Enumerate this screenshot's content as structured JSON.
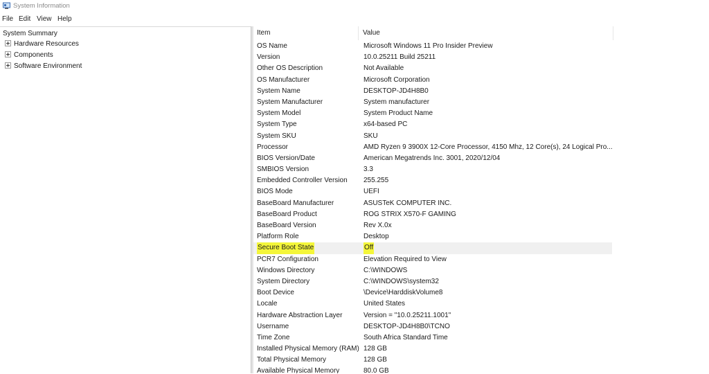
{
  "window": {
    "title": "System Information"
  },
  "menu": [
    "File",
    "Edit",
    "View",
    "Help"
  ],
  "tree": {
    "root": "System Summary",
    "nodes": [
      "Hardware Resources",
      "Components",
      "Software Environment"
    ]
  },
  "table": {
    "headers": {
      "item": "Item",
      "value": "Value"
    },
    "rows": [
      {
        "item": "OS Name",
        "value": "Microsoft Windows 11 Pro Insider Preview"
      },
      {
        "item": "Version",
        "value": "10.0.25211 Build 25211"
      },
      {
        "item": "Other OS Description",
        "value": "Not Available"
      },
      {
        "item": "OS Manufacturer",
        "value": "Microsoft Corporation"
      },
      {
        "item": "System Name",
        "value": "DESKTOP-JD4H8B0"
      },
      {
        "item": "System Manufacturer",
        "value": "System manufacturer"
      },
      {
        "item": "System Model",
        "value": "System Product Name"
      },
      {
        "item": "System Type",
        "value": "x64-based PC"
      },
      {
        "item": "System SKU",
        "value": "SKU"
      },
      {
        "item": "Processor",
        "value": "AMD Ryzen 9 3900X 12-Core Processor, 4150 Mhz, 12 Core(s), 24 Logical Pro..."
      },
      {
        "item": "BIOS Version/Date",
        "value": "American Megatrends Inc. 3001, 2020/12/04"
      },
      {
        "item": "SMBIOS Version",
        "value": "3.3"
      },
      {
        "item": "Embedded Controller Version",
        "value": "255.255"
      },
      {
        "item": "BIOS Mode",
        "value": "UEFI"
      },
      {
        "item": "BaseBoard Manufacturer",
        "value": "ASUSTeK COMPUTER INC."
      },
      {
        "item": "BaseBoard Product",
        "value": "ROG STRIX X570-F GAMING"
      },
      {
        "item": "BaseBoard Version",
        "value": "Rev X.0x"
      },
      {
        "item": "Platform Role",
        "value": "Desktop"
      },
      {
        "item": "Secure Boot State",
        "value": "Off",
        "highlighted": true
      },
      {
        "item": "PCR7 Configuration",
        "value": "Elevation Required to View"
      },
      {
        "item": "Windows Directory",
        "value": "C:\\WINDOWS"
      },
      {
        "item": "System Directory",
        "value": "C:\\WINDOWS\\system32"
      },
      {
        "item": "Boot Device",
        "value": "\\Device\\HarddiskVolume8"
      },
      {
        "item": "Locale",
        "value": "United States"
      },
      {
        "item": "Hardware Abstraction Layer",
        "value": "Version = \"10.0.25211.1001\""
      },
      {
        "item": "Username",
        "value": "DESKTOP-JD4H8B0\\TCNO"
      },
      {
        "item": "Time Zone",
        "value": "South Africa Standard Time"
      },
      {
        "item": "Installed Physical Memory (RAM)",
        "value": "128 GB"
      },
      {
        "item": "Total Physical Memory",
        "value": "128 GB"
      },
      {
        "item": "Available Physical Memory",
        "value": "80.0 GB"
      }
    ]
  }
}
